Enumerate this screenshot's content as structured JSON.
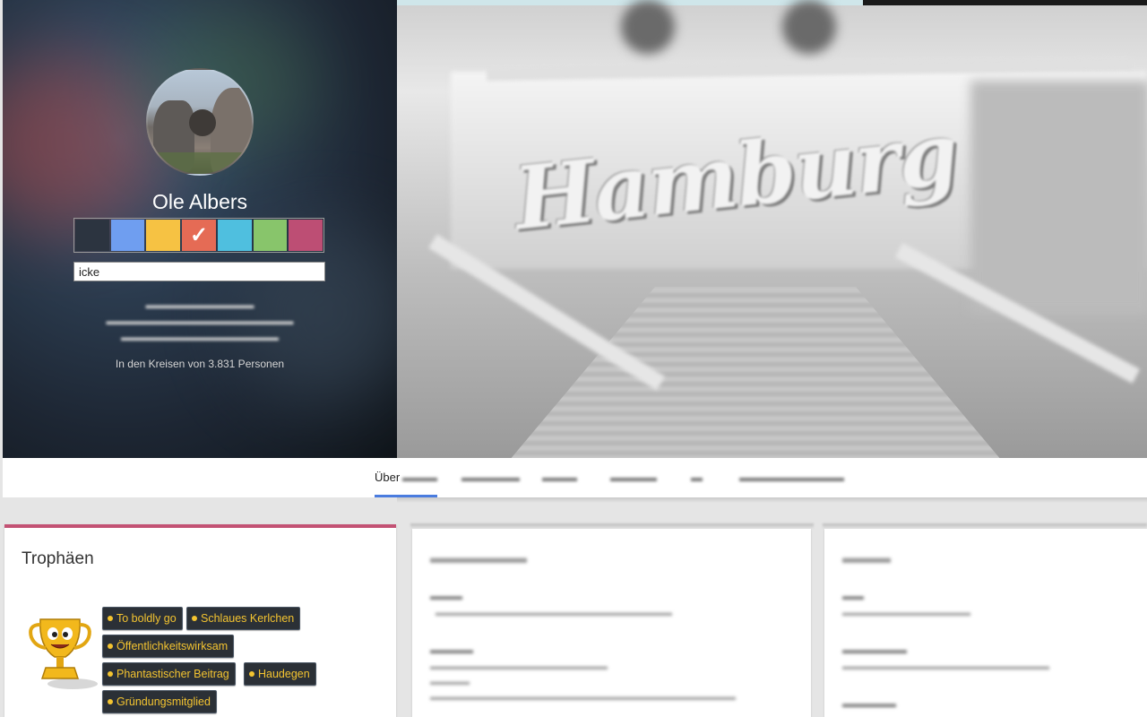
{
  "profile": {
    "name": "Ole Albers",
    "nickname_value": "icke",
    "circles_text": "In den Kreisen von 3.831 Personen",
    "color_swatches": [
      {
        "color": "#2c3440",
        "selected": false
      },
      {
        "color": "#6f9ef0",
        "selected": false
      },
      {
        "color": "#f6c243",
        "selected": false
      },
      {
        "color": "#e56b55",
        "selected": true
      },
      {
        "color": "#4fbfdf",
        "selected": false
      },
      {
        "color": "#88c56b",
        "selected": false
      },
      {
        "color": "#bd4e74",
        "selected": false
      }
    ],
    "check_glyph": "✓"
  },
  "tabs": {
    "overview_label": "Über"
  },
  "trophies": {
    "title": "Trophäen",
    "badges": [
      "To boldly go",
      "Schlaues Kerlchen",
      "Öffentlichkeitswirksam",
      "Phantastischer Beitrag",
      "Haudegen",
      "Gründungsmitglied"
    ]
  },
  "colors": {
    "accent_tab_underline": "#4a7cdf",
    "trophy_card_accent": "#c35274",
    "badge_text": "#f4c430",
    "badge_bg": "#2b3036"
  },
  "icons": {
    "trophy": "trophy-cup-icon",
    "check": "check-icon"
  }
}
